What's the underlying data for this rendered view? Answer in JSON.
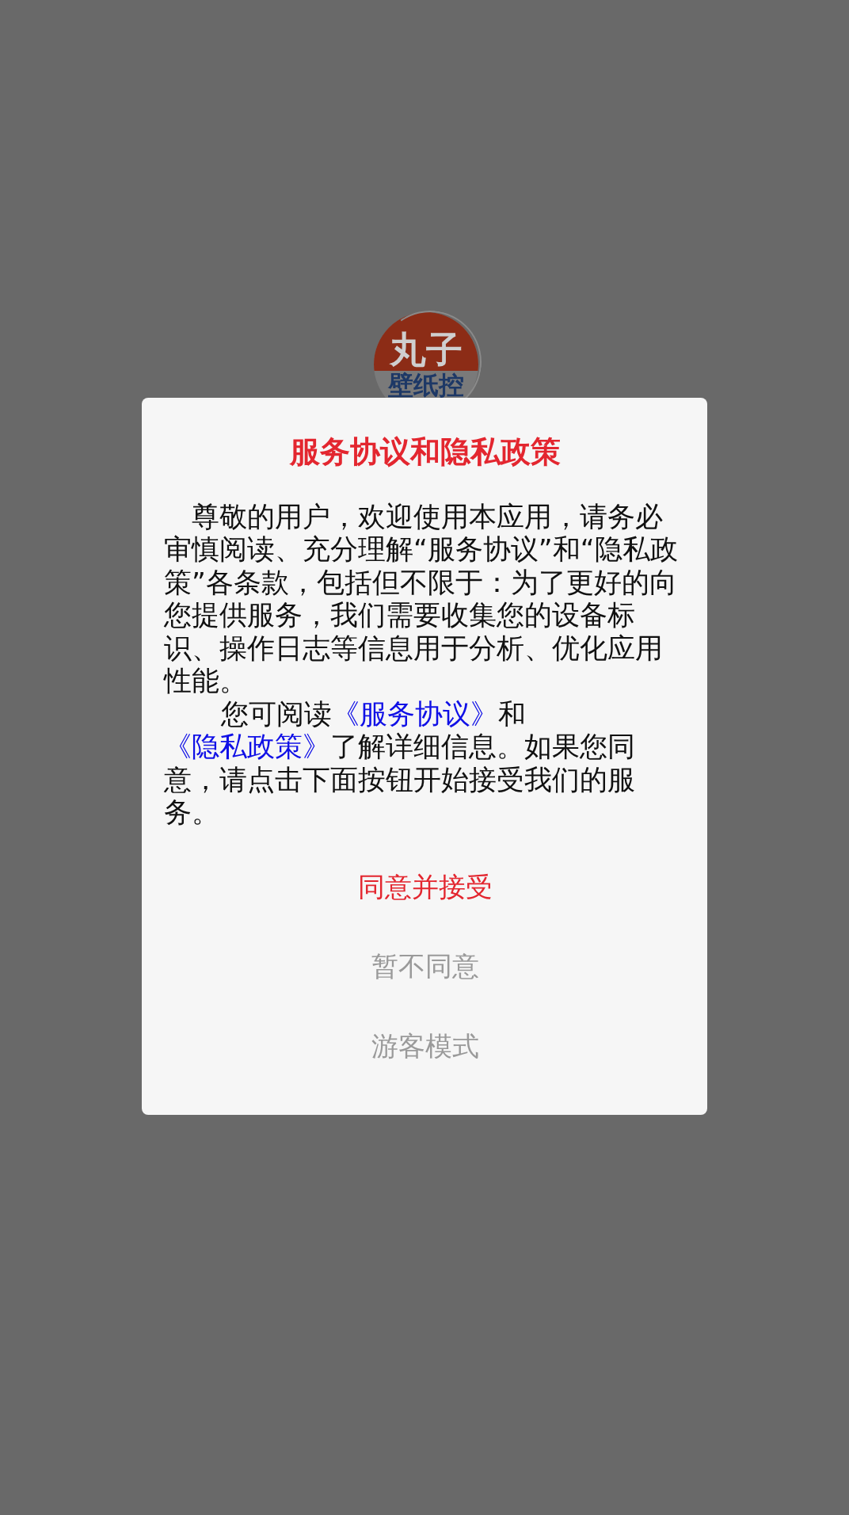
{
  "logo": {
    "title": "丸子",
    "subtitle": "壁纸控"
  },
  "dialog": {
    "title": "服务协议和隐私政策",
    "paragraphs": [
      {
        "segments": [
          {
            "kind": "text",
            "text": "尊敬的用户，欢迎使用本应用，请务必审慎阅读、充分理解“服务协议”和“隐私政策”各条款，包括但不限于：为了更好的向您提供服务，我们需要收集您的设备标识、操作日志等信息用于分析、优化应用性能。"
          }
        ]
      },
      {
        "segments": [
          {
            "kind": "text",
            "text": "您可阅读"
          },
          {
            "kind": "link",
            "text": "《服务协议》"
          },
          {
            "kind": "text",
            "text": "和"
          },
          {
            "kind": "link",
            "text": "《隐私政策》"
          },
          {
            "kind": "text",
            "text": "了解详细信息。如果您同意，请点击下面按钮开始接受我们的服务。"
          }
        ]
      }
    ],
    "buttons": [
      {
        "label": "同意并接受",
        "kind": "primary"
      },
      {
        "label": "暂不同意",
        "kind": "secondary"
      },
      {
        "label": "游客模式",
        "kind": "secondary"
      }
    ]
  }
}
